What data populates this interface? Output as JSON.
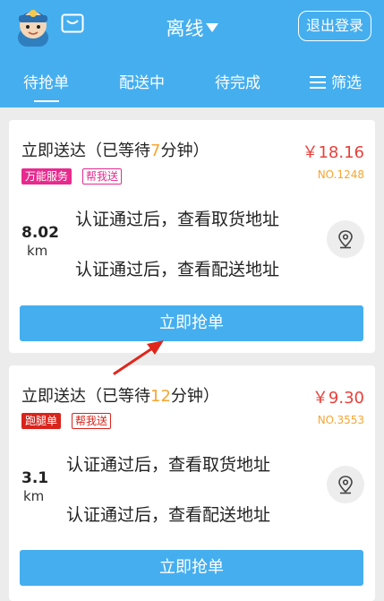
{
  "header": {
    "status_label": "离线",
    "logout_label": "退出登录"
  },
  "tabs": [
    {
      "label": "待抢单",
      "active": true
    },
    {
      "label": "配送中"
    },
    {
      "label": "待完成"
    },
    {
      "label": "筛选"
    }
  ],
  "orders": [
    {
      "title_prefix": "立即送达（已等待",
      "wait_minutes": "7",
      "title_suffix": "分钟）",
      "price": "￥18.16",
      "order_no": "NO.1248",
      "tags": [
        "万能服务",
        "帮我送"
      ],
      "distance": "8.02",
      "distance_unit": "km",
      "pickup_text": "认证通过后，查看取货地址",
      "delivery_text": "认证通过后，查看配送地址",
      "button_label": "立即抢单"
    },
    {
      "title_prefix": "立即送达（已等待",
      "wait_minutes": "12",
      "title_suffix": "分钟）",
      "price": "￥9.30",
      "order_no": "NO.3553",
      "tags": [
        "跑腿单",
        "帮我送"
      ],
      "distance": "3.1",
      "distance_unit": "km",
      "pickup_text": "认证通过后，查看取货地址",
      "delivery_text": "认证通过后，查看配送地址",
      "button_label": "立即抢单"
    }
  ],
  "colors": {
    "brand_blue": "#45aeef",
    "price_red": "#e8413b",
    "accent_orange": "#f7a532",
    "arrow_red": "#e0261d"
  },
  "icons": [
    "avatar",
    "message-icon",
    "caret-down-icon",
    "filter-icon",
    "location-icon"
  ]
}
